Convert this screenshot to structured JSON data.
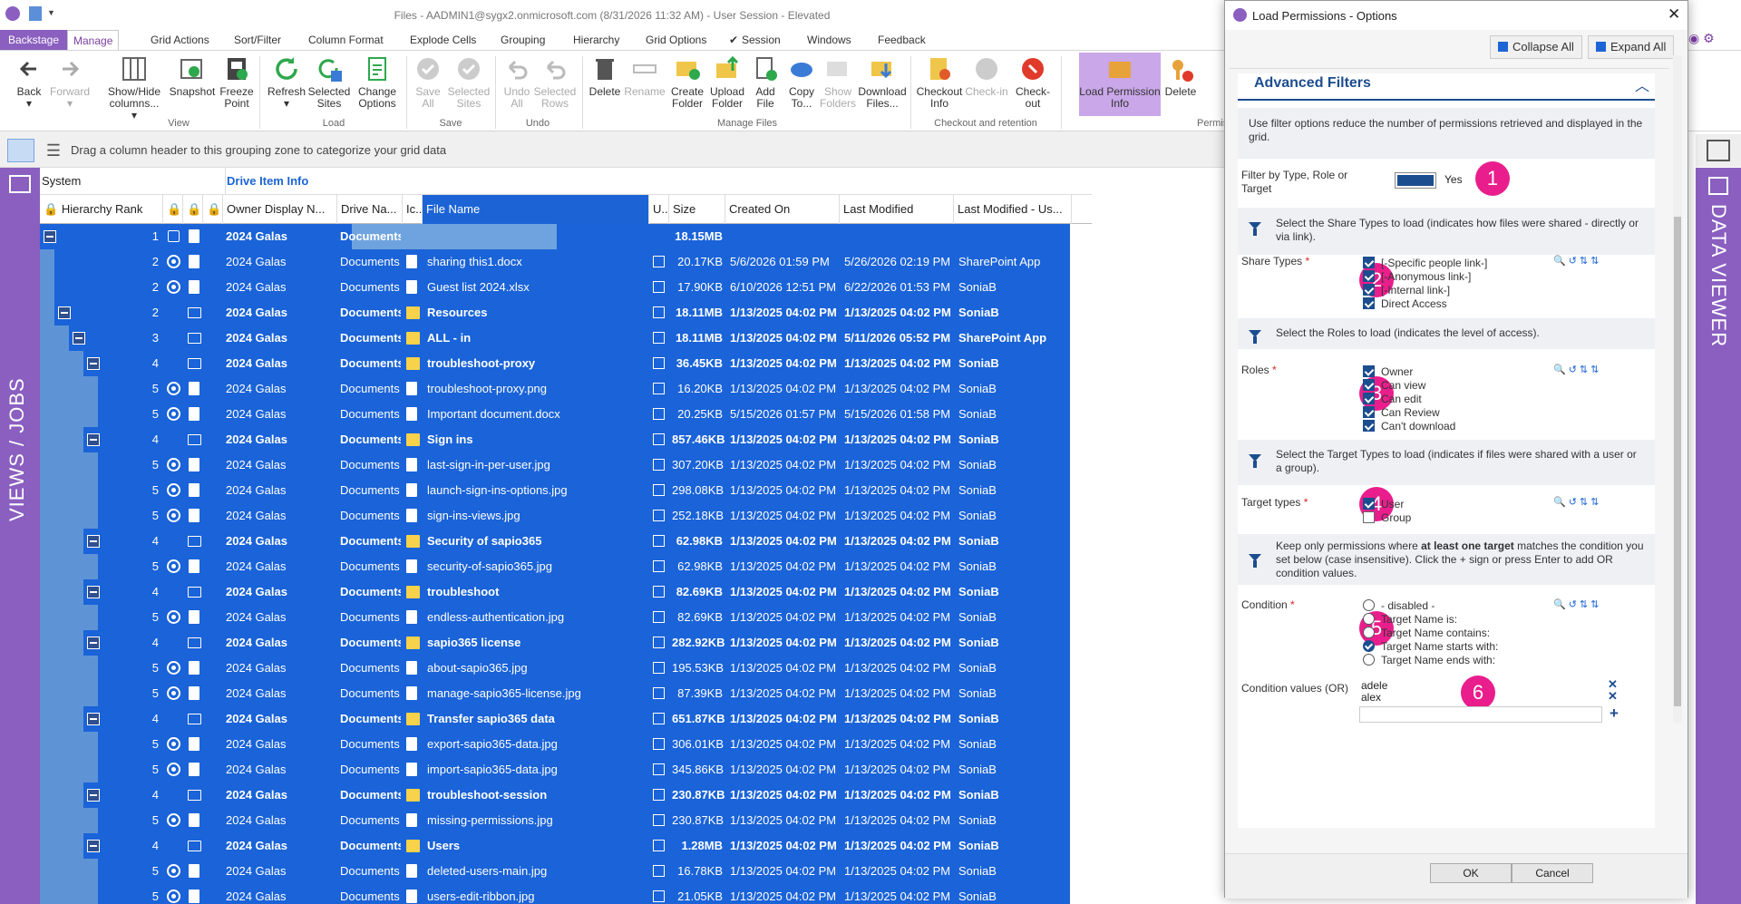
{
  "window": {
    "title": "Files - AADMIN1@sygx2.onmicrosoft.com (8/31/2026 11:32 AM) - User Session - Elevated"
  },
  "tabs": [
    "Backstage",
    "Manage",
    "Grid Actions",
    "Sort/Filter",
    "Column Format",
    "Explode Cells",
    "Grouping",
    "Hierarchy",
    "Grid Options",
    "Session",
    "Windows",
    "Feedback"
  ],
  "ribbon": {
    "view": [
      "Back",
      "Forward",
      "Show/Hide columns...",
      "Snapshot",
      "Freeze Point"
    ],
    "view_group": "View",
    "load": [
      "Refresh",
      "Selected Sites",
      "Change Options"
    ],
    "load_group": "Load",
    "save": [
      "Save All",
      "Selected Sites"
    ],
    "save_group": "Save",
    "undo": [
      "Undo All",
      "Selected Rows"
    ],
    "undo_group": "Undo",
    "files": [
      "Delete",
      "Rename",
      "Create Folder",
      "Upload Folder",
      "Add File",
      "Copy To...",
      "Show Folders",
      "Download Files..."
    ],
    "files_group": "Manage Files",
    "checkout": [
      "Checkout Info",
      "Check-in",
      "Check-out"
    ],
    "checkout_group": "Checkout and retention",
    "perm": [
      "Load Permission Info",
      "Delete"
    ],
    "perm_group": "Permis"
  },
  "groupbar": {
    "hint": "Drag a column header to this grouping zone to categorize your grid data"
  },
  "leftpanel": {
    "label": "VIEWS / JOBS"
  },
  "rightpanel": {
    "label": "DATA VIEWER"
  },
  "grid": {
    "band_system": "System",
    "band_drive": "Drive Item Info",
    "columns": [
      "Hierarchy Rank",
      "Owner Display N...",
      "Drive Na...",
      "Ic...",
      "File Name",
      "U...",
      "Size",
      "Created On",
      "Last Modified",
      "Last Modified - Us..."
    ],
    "rows": [
      {
        "rank": "1",
        "owner": "2024 Galas",
        "drive": "Documents",
        "file": "",
        "size": "18.15MB",
        "created": "",
        "modified": "",
        "by": "",
        "bold": true
      },
      {
        "rank": "2",
        "owner": "2024 Galas",
        "drive": "Documents",
        "file": "sharing this1.docx",
        "size": "20.17KB",
        "created": "5/6/2026 01:59 PM",
        "modified": "5/26/2026 02:19 PM",
        "by": "SharePoint App",
        "bold": false
      },
      {
        "rank": "2",
        "owner": "2024 Galas",
        "drive": "Documents",
        "file": "Guest list 2024.xlsx",
        "size": "17.90KB",
        "created": "6/10/2026 12:51 PM",
        "modified": "6/22/2026 01:53 PM",
        "by": "SoniaB",
        "bold": false
      },
      {
        "rank": "2",
        "owner": "2024 Galas",
        "drive": "Documents",
        "file": "Resources",
        "size": "18.11MB",
        "created": "1/13/2025 04:02 PM",
        "modified": "1/13/2025 04:02 PM",
        "by": "SoniaB",
        "bold": true
      },
      {
        "rank": "3",
        "owner": "2024 Galas",
        "drive": "Documents",
        "file": "ALL - in",
        "size": "18.11MB",
        "created": "1/13/2025 04:02 PM",
        "modified": "5/11/2026 05:52 PM",
        "by": "SharePoint App",
        "bold": true
      },
      {
        "rank": "4",
        "owner": "2024 Galas",
        "drive": "Documents",
        "file": "troubleshoot-proxy",
        "size": "36.45KB",
        "created": "1/13/2025 04:02 PM",
        "modified": "1/13/2025 04:02 PM",
        "by": "SoniaB",
        "bold": true
      },
      {
        "rank": "5",
        "owner": "2024 Galas",
        "drive": "Documents",
        "file": "troubleshoot-proxy.png",
        "size": "16.20KB",
        "created": "1/13/2025 04:02 PM",
        "modified": "1/13/2025 04:02 PM",
        "by": "SoniaB",
        "bold": false
      },
      {
        "rank": "5",
        "owner": "2024 Galas",
        "drive": "Documents",
        "file": "Important document.docx",
        "size": "20.25KB",
        "created": "5/15/2026 01:57 PM",
        "modified": "5/15/2026 01:58 PM",
        "by": "SoniaB",
        "bold": false
      },
      {
        "rank": "4",
        "owner": "2024 Galas",
        "drive": "Documents",
        "file": "Sign ins",
        "size": "857.46KB",
        "created": "1/13/2025 04:02 PM",
        "modified": "1/13/2025 04:02 PM",
        "by": "SoniaB",
        "bold": true
      },
      {
        "rank": "5",
        "owner": "2024 Galas",
        "drive": "Documents",
        "file": "last-sign-in-per-user.jpg",
        "size": "307.20KB",
        "created": "1/13/2025 04:02 PM",
        "modified": "1/13/2025 04:02 PM",
        "by": "SoniaB",
        "bold": false
      },
      {
        "rank": "5",
        "owner": "2024 Galas",
        "drive": "Documents",
        "file": "launch-sign-ins-options.jpg",
        "size": "298.08KB",
        "created": "1/13/2025 04:02 PM",
        "modified": "1/13/2025 04:02 PM",
        "by": "SoniaB",
        "bold": false
      },
      {
        "rank": "5",
        "owner": "2024 Galas",
        "drive": "Documents",
        "file": "sign-ins-views.jpg",
        "size": "252.18KB",
        "created": "1/13/2025 04:02 PM",
        "modified": "1/13/2025 04:02 PM",
        "by": "SoniaB",
        "bold": false
      },
      {
        "rank": "4",
        "owner": "2024 Galas",
        "drive": "Documents",
        "file": "Security of sapio365",
        "size": "62.98KB",
        "created": "1/13/2025 04:02 PM",
        "modified": "1/13/2025 04:02 PM",
        "by": "SoniaB",
        "bold": true
      },
      {
        "rank": "5",
        "owner": "2024 Galas",
        "drive": "Documents",
        "file": "security-of-sapio365.jpg",
        "size": "62.98KB",
        "created": "1/13/2025 04:02 PM",
        "modified": "1/13/2025 04:02 PM",
        "by": "SoniaB",
        "bold": false
      },
      {
        "rank": "4",
        "owner": "2024 Galas",
        "drive": "Documents",
        "file": "troubleshoot",
        "size": "82.69KB",
        "created": "1/13/2025 04:02 PM",
        "modified": "1/13/2025 04:02 PM",
        "by": "SoniaB",
        "bold": true
      },
      {
        "rank": "5",
        "owner": "2024 Galas",
        "drive": "Documents",
        "file": "endless-authentication.jpg",
        "size": "82.69KB",
        "created": "1/13/2025 04:02 PM",
        "modified": "1/13/2025 04:02 PM",
        "by": "SoniaB",
        "bold": false
      },
      {
        "rank": "4",
        "owner": "2024 Galas",
        "drive": "Documents",
        "file": "sapio365 license",
        "size": "282.92KB",
        "created": "1/13/2025 04:02 PM",
        "modified": "1/13/2025 04:02 PM",
        "by": "SoniaB",
        "bold": true
      },
      {
        "rank": "5",
        "owner": "2024 Galas",
        "drive": "Documents",
        "file": "about-sapio365.jpg",
        "size": "195.53KB",
        "created": "1/13/2025 04:02 PM",
        "modified": "1/13/2025 04:02 PM",
        "by": "SoniaB",
        "bold": false
      },
      {
        "rank": "5",
        "owner": "2024 Galas",
        "drive": "Documents",
        "file": "manage-sapio365-license.jpg",
        "size": "87.39KB",
        "created": "1/13/2025 04:02 PM",
        "modified": "1/13/2025 04:02 PM",
        "by": "SoniaB",
        "bold": false
      },
      {
        "rank": "4",
        "owner": "2024 Galas",
        "drive": "Documents",
        "file": "Transfer sapio365 data",
        "size": "651.87KB",
        "created": "1/13/2025 04:02 PM",
        "modified": "1/13/2025 04:02 PM",
        "by": "SoniaB",
        "bold": true
      },
      {
        "rank": "5",
        "owner": "2024 Galas",
        "drive": "Documents",
        "file": "export-sapio365-data.jpg",
        "size": "306.01KB",
        "created": "1/13/2025 04:02 PM",
        "modified": "1/13/2025 04:02 PM",
        "by": "SoniaB",
        "bold": false
      },
      {
        "rank": "5",
        "owner": "2024 Galas",
        "drive": "Documents",
        "file": "import-sapio365-data.jpg",
        "size": "345.86KB",
        "created": "1/13/2025 04:02 PM",
        "modified": "1/13/2025 04:02 PM",
        "by": "SoniaB",
        "bold": false
      },
      {
        "rank": "4",
        "owner": "2024 Galas",
        "drive": "Documents",
        "file": "troubleshoot-session",
        "size": "230.87KB",
        "created": "1/13/2025 04:02 PM",
        "modified": "1/13/2025 04:02 PM",
        "by": "SoniaB",
        "bold": true
      },
      {
        "rank": "5",
        "owner": "2024 Galas",
        "drive": "Documents",
        "file": "missing-permissions.jpg",
        "size": "230.87KB",
        "created": "1/13/2025 04:02 PM",
        "modified": "1/13/2025 04:02 PM",
        "by": "SoniaB",
        "bold": false
      },
      {
        "rank": "4",
        "owner": "2024 Galas",
        "drive": "Documents",
        "file": "Users",
        "size": "1.28MB",
        "created": "1/13/2025 04:02 PM",
        "modified": "1/13/2025 04:02 PM",
        "by": "SoniaB",
        "bold": true
      },
      {
        "rank": "5",
        "owner": "2024 Galas",
        "drive": "Documents",
        "file": "deleted-users-main.jpg",
        "size": "16.78KB",
        "created": "1/13/2025 04:02 PM",
        "modified": "1/13/2025 04:02 PM",
        "by": "SoniaB",
        "bold": false
      },
      {
        "rank": "5",
        "owner": "2024 Galas",
        "drive": "Documents",
        "file": "users-edit-ribbon.jpg",
        "size": "21.05KB",
        "created": "1/13/2025 04:02 PM",
        "modified": "1/13/2025 04:02 PM",
        "by": "SoniaB",
        "bold": false
      }
    ]
  },
  "dialog": {
    "title": "Load Permissions - Options",
    "collapse_all": "Collapse All",
    "expand_all": "Expand All",
    "section_title": "Advanced Filters",
    "intro": "Use filter options reduce the number of permissions retrieved and displayed in the grid.",
    "filter_label": "Filter by Type, Role or Target",
    "filter_value": "Yes",
    "share_help": "Select the Share Types to load (indicates how files were shared - directly or via link).",
    "share_label": "Share Types",
    "share_types": [
      "[-Specific people link-]",
      "[-Anonymous link-]",
      "[-Internal link-]",
      "Direct Access"
    ],
    "roles_help": "Select the Roles to load (indicates the level of access).",
    "roles_label": "Roles",
    "roles": [
      "Owner",
      "Can view",
      "Can edit",
      "Can Review",
      "Can't download"
    ],
    "target_help": "Select the Target Types to load (indicates if files were shared with a user or a group).",
    "target_label": "Target types",
    "target_types": [
      {
        "label": "User",
        "checked": true
      },
      {
        "label": "Group",
        "checked": false
      }
    ],
    "cond_help_pre": "Keep only permissions where ",
    "cond_help_bold": "at least one target",
    "cond_help_post": " matches the condition you set below (case insensitive). Click the + sign or press Enter to add OR condition values.",
    "condition_label": "Condition",
    "conditions": [
      {
        "label": "- disabled -",
        "selected": false
      },
      {
        "label": "Target Name is:",
        "selected": false
      },
      {
        "label": "Target Name contains:",
        "selected": false
      },
      {
        "label": "Target Name starts with:",
        "selected": true
      },
      {
        "label": "Target Name ends with:",
        "selected": false
      }
    ],
    "values_label": "Condition values (OR)",
    "values": [
      "adele",
      "alex"
    ],
    "required_mark": "*",
    "badges": [
      "1",
      "2",
      "3",
      "4",
      "5",
      "6"
    ],
    "ok": "OK",
    "cancel": "Cancel"
  },
  "colors": {
    "accent": "#8a5fc0",
    "selection": "#1a63d8",
    "badge": "#e91e8c",
    "brand_blue": "#1c64d6"
  }
}
